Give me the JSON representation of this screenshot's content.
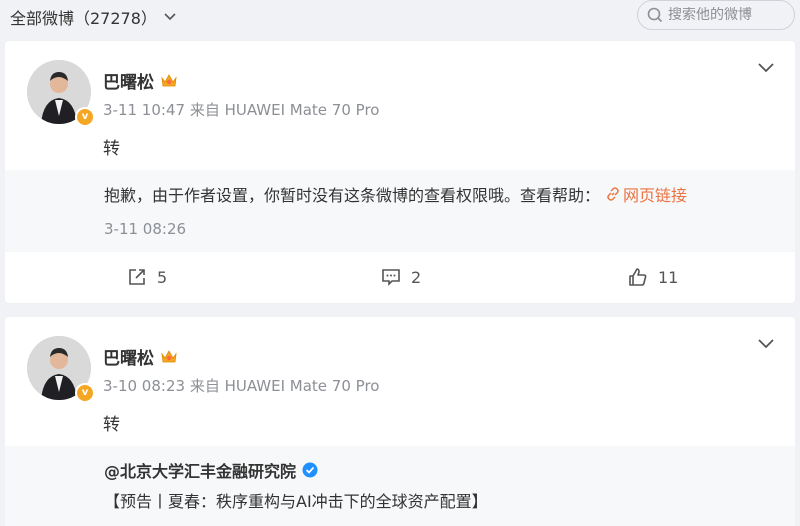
{
  "header": {
    "filter_label": "全部微博（27278）",
    "search_placeholder": "搜索他的微博"
  },
  "posts": [
    {
      "author": "巴曙松",
      "time": "3-11 10:47",
      "source": "来自 HUAWEI Mate 70 Pro",
      "text": "转",
      "repost": {
        "notice": "抱歉，由于作者设置，你暂时没有这条微博的查看权限哦。查看帮助：",
        "link_label": "网页链接",
        "time": "3-11 08:26"
      },
      "actions": {
        "reposts": "5",
        "comments": "2",
        "likes": "11"
      }
    },
    {
      "author": "巴曙松",
      "time": "3-10 08:23",
      "source": "来自 HUAWEI Mate 70 Pro",
      "text": "转",
      "repost": {
        "author": "@北京大学汇丰金融研究院",
        "text": "【预告丨夏春：秩序重构与AI冲击下的全球资产配置】"
      }
    }
  ],
  "colors": {
    "link": "#eb7340",
    "verified_gold": "#f5a623",
    "verified_blue": "#1e90ff"
  }
}
